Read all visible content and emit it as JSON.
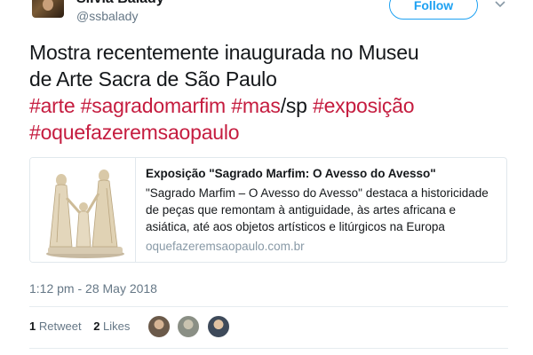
{
  "author": {
    "display_name": "Silvia Balady",
    "handle": "@ssbalady"
  },
  "follow_button": {
    "label": "Follow"
  },
  "tweet": {
    "text_line1": "Mostra recentemente inaugurada no Museu",
    "text_line2": "de Arte Sacra de São Paulo",
    "hashtags": {
      "arte": "#arte",
      "sagradomarfim": "#sagradomarfim",
      "mas": "#mas",
      "sp": "/sp",
      "exposicao": "#exposição",
      "oquefazer": "#oquefazeremsaopaulo"
    }
  },
  "card": {
    "title": "Exposição \"Sagrado Marfim: O Avesso do Avesso\"",
    "description": "\"Sagrado Marfim – O Avesso do Avesso\" destaca a historicidade de peças que remontam à antiguidade, às artes africana e asiática, até aos objetos artísticos e litúrgicos na Europa",
    "url": "oquefazeremsaopaulo.com.br",
    "image_icon": "ivory-sculpture-image"
  },
  "timestamp": "1:12 pm - 28 May 2018",
  "stats": {
    "retweets_count": "1",
    "retweets_label": "Retweet",
    "likes_count": "2",
    "likes_label": "Likes"
  },
  "likers": [
    {
      "icon": "liker-avatar",
      "color": "#6b5a4a"
    },
    {
      "icon": "liker-avatar",
      "color": "#8a8f85"
    },
    {
      "icon": "liker-avatar",
      "color": "#3e4a5a"
    }
  ],
  "colors": {
    "hashtag": "#c51c3f",
    "follow_accent": "#1da1f2",
    "secondary_text": "#657786"
  }
}
